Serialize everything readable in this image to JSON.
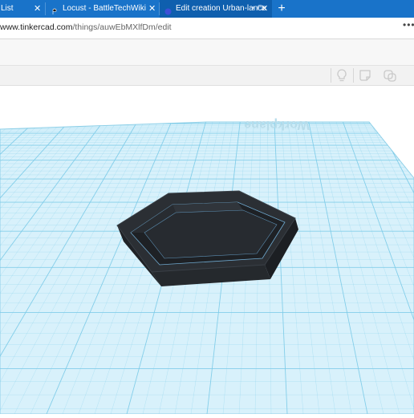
{
  "browser": {
    "tabs": [
      {
        "title": "List",
        "close": "✕"
      },
      {
        "title": "Locust - BattleTechWiki",
        "close": "✕"
      },
      {
        "title": "Edit creation Urban-lance",
        "suffix": "• C",
        "close": "✕"
      }
    ],
    "new_tab": "+",
    "url_host": "www.tinkercad.com",
    "url_path": "/things/auwEbMXlfDm/edit",
    "more": "•••"
  },
  "workplane": {
    "label": "Workplane"
  },
  "colors": {
    "tab_bar": "#1973c9",
    "grid_fill": "#d8f1fb",
    "grid_line": "#7ccbe8",
    "object": "#2b2f34"
  }
}
